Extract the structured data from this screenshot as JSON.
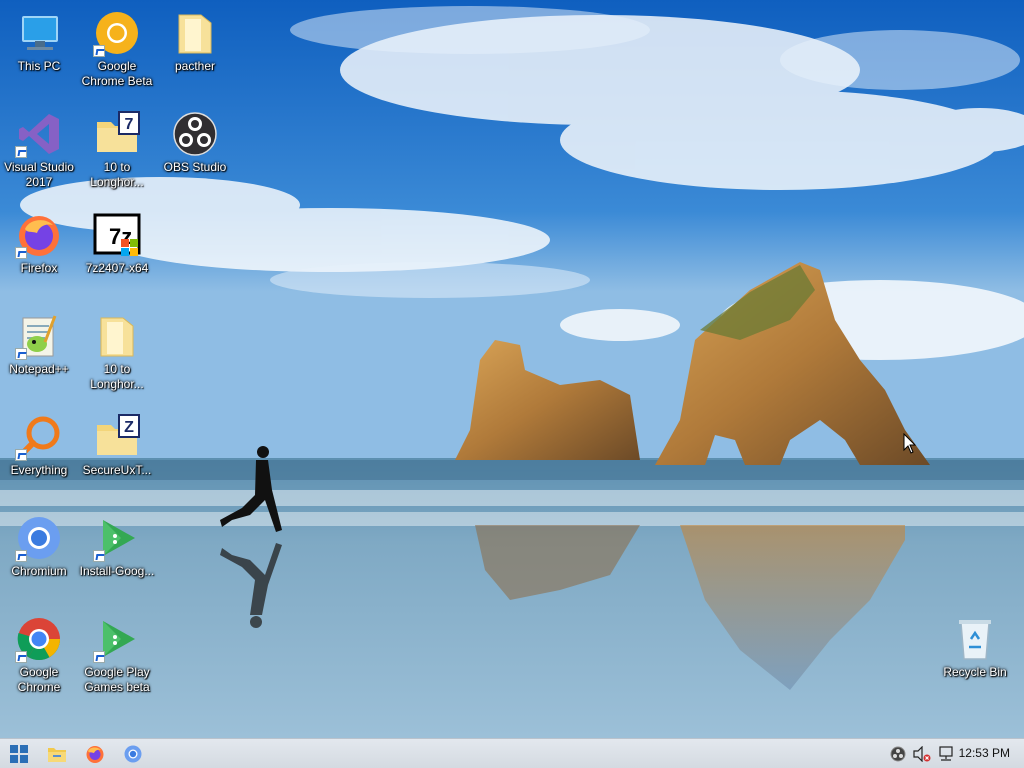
{
  "desktop_icons": [
    {
      "name": "This PC",
      "icon": "this-pc-icon"
    },
    {
      "name": "Google Chrome Beta",
      "icon": "chrome-beta-icon"
    },
    {
      "name": "pacther",
      "icon": "folder-icon"
    },
    {
      "name": "Visual Studio 2017",
      "icon": "visual-studio-icon"
    },
    {
      "name": "10 to Longhor...",
      "icon": "winrar-icon"
    },
    {
      "name": "OBS Studio",
      "icon": "obs-icon"
    },
    {
      "name": "Firefox",
      "icon": "firefox-icon"
    },
    {
      "name": "7z2407-x64",
      "icon": "7zip-installer-icon"
    },
    {
      "name": "Notepad++",
      "icon": "notepadpp-icon"
    },
    {
      "name": "10 to Longhor...",
      "icon": "folder-icon"
    },
    {
      "name": "Everything",
      "icon": "everything-search-icon"
    },
    {
      "name": "SecureUxT...",
      "icon": "archive-icon"
    },
    {
      "name": "Chromium",
      "icon": "chromium-icon"
    },
    {
      "name": "Install-Goog...",
      "icon": "google-play-games-installer-icon"
    },
    {
      "name": "Google Chrome",
      "icon": "chrome-icon"
    },
    {
      "name": "Google Play Games beta",
      "icon": "google-play-games-icon"
    },
    {
      "name": "Recycle Bin",
      "icon": "recycle-bin-icon"
    }
  ],
  "taskbar": {
    "start_icon": "windows-start-icon",
    "pinned": [
      "file-explorer-icon",
      "firefox-icon",
      "chromium-icon"
    ],
    "tray_icons": [
      "obs-tray-icon",
      "volume-muted-icon",
      "network-icon"
    ],
    "clock": "12:53 PM"
  },
  "colors": {
    "taskbar_bg": "#dde3e9",
    "label_text": "#ffffff",
    "sky": "#1f6fc4"
  }
}
